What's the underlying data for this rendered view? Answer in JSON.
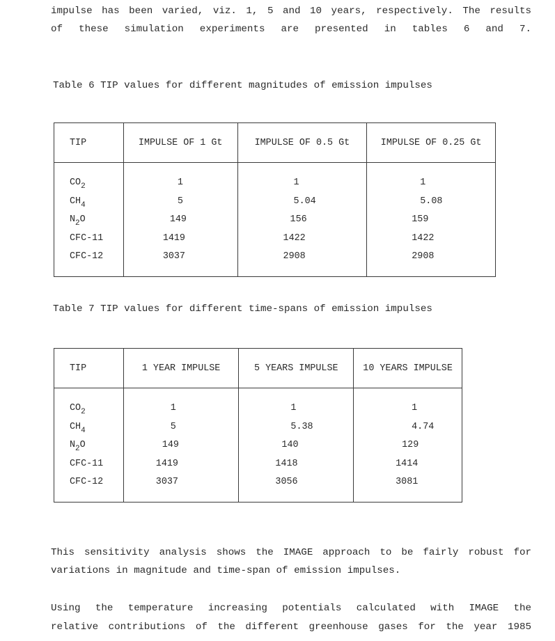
{
  "intro": {
    "line1": "impulse has been varied, viz. 1, 5 and 10 years, respectively.  The  results",
    "line2": "of  these  simulation  experiments  are  presented  in  tables  6  and  7."
  },
  "table6": {
    "caption": "Table 6 TIP values for different magnitudes of emission impulses",
    "headers": [
      "TIP",
      "IMPULSE OF 1 Gt",
      "IMPULSE OF 0.5 Gt",
      "IMPULSE OF 0.25 Gt"
    ],
    "gases": [
      {
        "base": "CO",
        "sub": "2",
        "tail": ""
      },
      {
        "base": "CH",
        "sub": "4",
        "tail": ""
      },
      {
        "base": "N",
        "sub": "2",
        "tail": "O"
      },
      {
        "base": "CFC-11",
        "sub": "",
        "tail": ""
      },
      {
        "base": "CFC-12",
        "sub": "",
        "tail": ""
      }
    ],
    "col1": [
      "1",
      "5",
      "149",
      "1419",
      "3037"
    ],
    "col2": [
      "1",
      "5.04",
      "156",
      "1422",
      "2908"
    ],
    "col3": [
      "1",
      "5.08",
      "159",
      "1422",
      "2908"
    ]
  },
  "table7": {
    "caption": "Table 7 TIP values for different time-spans of emission impulses",
    "headers": [
      "TIP",
      "1 YEAR IMPULSE",
      "5 YEARS IMPULSE",
      "10 YEARS IMPULSE"
    ],
    "gases": [
      {
        "base": "CO",
        "sub": "2",
        "tail": ""
      },
      {
        "base": "CH",
        "sub": "4",
        "tail": ""
      },
      {
        "base": "N",
        "sub": "2",
        "tail": "O"
      },
      {
        "base": "CFC-11",
        "sub": "",
        "tail": ""
      },
      {
        "base": "CFC-12",
        "sub": "",
        "tail": ""
      }
    ],
    "col1": [
      "1",
      "5",
      "149",
      "1419",
      "3037"
    ],
    "col2": [
      "1",
      "5.38",
      "140",
      "1418",
      "3056"
    ],
    "col3": [
      "1",
      "4.74",
      "129",
      "1414",
      "3081"
    ]
  },
  "conclusion": {
    "line1": "This sensitivity analysis shows the IMAGE approach to be fairly  robust  for",
    "line2": "variations in magnitude and time-span of emission impulses.",
    "line3": "Using the  temperature  increasing  potentials  calculated  with  IMAGE  the",
    "line4": "relative  contributions  of the different greenhouse gases for the year 1985"
  }
}
